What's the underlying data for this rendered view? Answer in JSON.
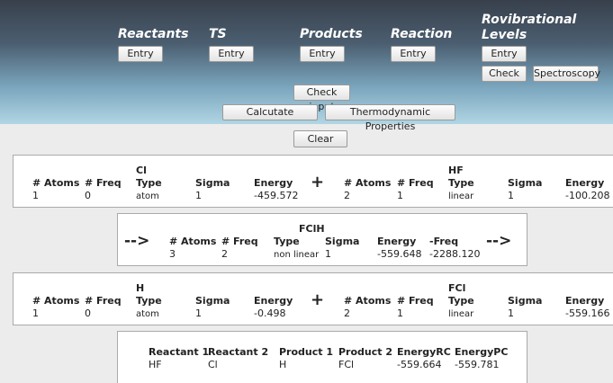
{
  "sections": {
    "reactants": "Reactants",
    "ts": "TS",
    "products": "Products",
    "reaction": "Reaction",
    "rovibrational_line1": "Rovibrational",
    "rovibrational_line2": "Levels"
  },
  "buttons": {
    "entry": "Entry",
    "check": "Check",
    "spectroscopy": "Spectroscopy",
    "check_input": "Check input",
    "calculate": "Calcutate",
    "thermo": "Thermodynamic Properties",
    "clear": "Clear"
  },
  "headers": {
    "atoms": "# Atoms",
    "freq": "# Freq",
    "type": "Type",
    "sigma": "Sigma",
    "energy": "Energy",
    "neg_freq": "-Freq"
  },
  "symbols": {
    "plus": "+",
    "arrow": "-->"
  },
  "reactants_row": {
    "left": {
      "atoms": "1",
      "freq": "0",
      "name": "Cl",
      "type": "atom",
      "sigma": "1",
      "energy": "-459.572"
    },
    "right": {
      "atoms": "2",
      "freq": "1",
      "name": "HF",
      "type": "linear",
      "sigma": "1",
      "energy": "-100.208"
    }
  },
  "ts_row": {
    "name": "FClH",
    "atoms": "3",
    "freq": "2",
    "type": "non linear",
    "sigma": "1",
    "energy": "-559.648",
    "neg_freq": "-2288.120"
  },
  "products_row": {
    "left": {
      "atoms": "1",
      "freq": "0",
      "name": "H",
      "type": "atom",
      "sigma": "1",
      "energy": "-0.498"
    },
    "right": {
      "atoms": "2",
      "freq": "1",
      "name": "FCl",
      "type": "linear",
      "sigma": "1",
      "energy": "-559.166"
    }
  },
  "summary": {
    "headers": [
      "Reactant 1",
      "Reactant 2",
      "Product 1",
      "Product 2",
      "EnergyRC",
      "EnergyPC"
    ],
    "values": [
      "HF",
      "Cl",
      "H",
      "FCl",
      "-559.664",
      "-559.781"
    ]
  }
}
